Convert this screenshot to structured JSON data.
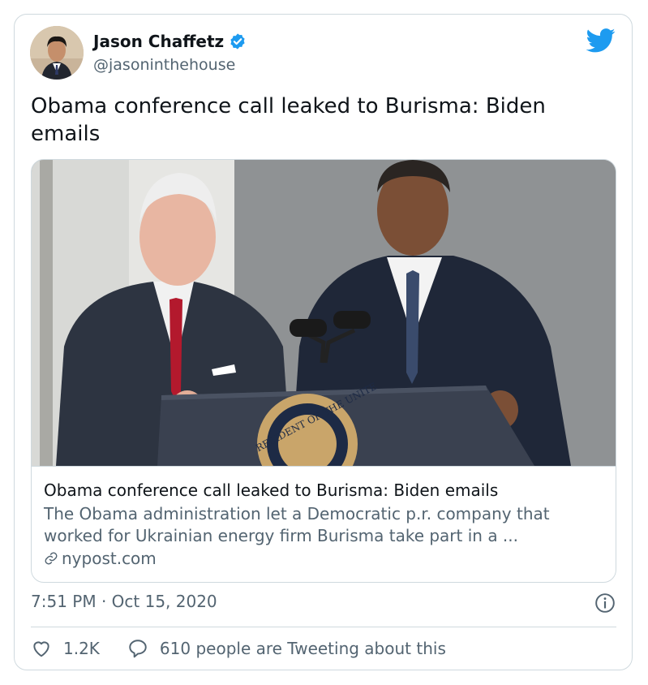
{
  "author": {
    "name": "Jason Chaffetz",
    "handle": "@jasoninthehouse",
    "verified": true,
    "avatar_icon": "avatar"
  },
  "tweet": {
    "text": "Obama conference call leaked to Burisma: Biden emails"
  },
  "link_card": {
    "image_description": "Photo",
    "title": "Obama conference call leaked to Burisma: Biden emails",
    "description": "The Obama administration let a Democratic p.r. company that worked for Ukrainian energy firm Burisma take part in a ...",
    "domain": "nypost.com",
    "seal_text": "RESIDENT OF THE UNITE"
  },
  "timestamp": "7:51 PM · Oct 15, 2020",
  "actions": {
    "likes": "1.2K",
    "conversation": "610 people are Tweeting about this"
  },
  "colors": {
    "brand_blue": "#1d9bf0",
    "secondary_text": "#536471",
    "border": "#cfd9de"
  }
}
